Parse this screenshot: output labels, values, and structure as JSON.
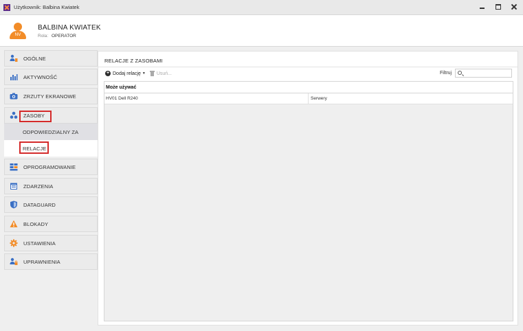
{
  "window": {
    "title": "Użytkownik: Balbina Kwiatek"
  },
  "user": {
    "initials": "NV",
    "name": "BALBINA KWIATEK",
    "role_label": "Rola:",
    "role": "OPERATOR"
  },
  "sidebar": {
    "items": [
      {
        "label": "OGÓLNE",
        "icon": "user-settings-icon"
      },
      {
        "label": "AKTYWNOŚĆ",
        "icon": "bar-chart-icon"
      },
      {
        "label": "ZRZUTY EKRANOWE",
        "icon": "camera-icon"
      },
      {
        "label": "ZASOBY",
        "icon": "resources-icon"
      },
      {
        "label": "OPROGRAMOWANIE",
        "icon": "software-icon"
      },
      {
        "label": "ZDARZENIA",
        "icon": "calendar-icon"
      },
      {
        "label": "DATAGUARD",
        "icon": "shield-icon"
      },
      {
        "label": "BLOKADY",
        "icon": "warning-icon"
      },
      {
        "label": "USTAWIENIA",
        "icon": "gear-icon"
      },
      {
        "label": "UPRAWNIENIA",
        "icon": "permissions-icon"
      }
    ],
    "sub_items": [
      {
        "label": "ODPOWIEDZIALNY ZA"
      },
      {
        "label": "RELACJE"
      }
    ]
  },
  "panel": {
    "title": "RELACJE Z ZASOBAMI",
    "add_label": "Dodaj relację",
    "remove_label": "Usuń...",
    "filter_label": "Filtruj"
  },
  "grid": {
    "group_header": "Może używać",
    "rows": [
      {
        "name": "HV01 Dell R240",
        "category": "Serwery"
      }
    ]
  },
  "colors": {
    "accent": "#f28c28",
    "highlight": "#d42a2a"
  }
}
